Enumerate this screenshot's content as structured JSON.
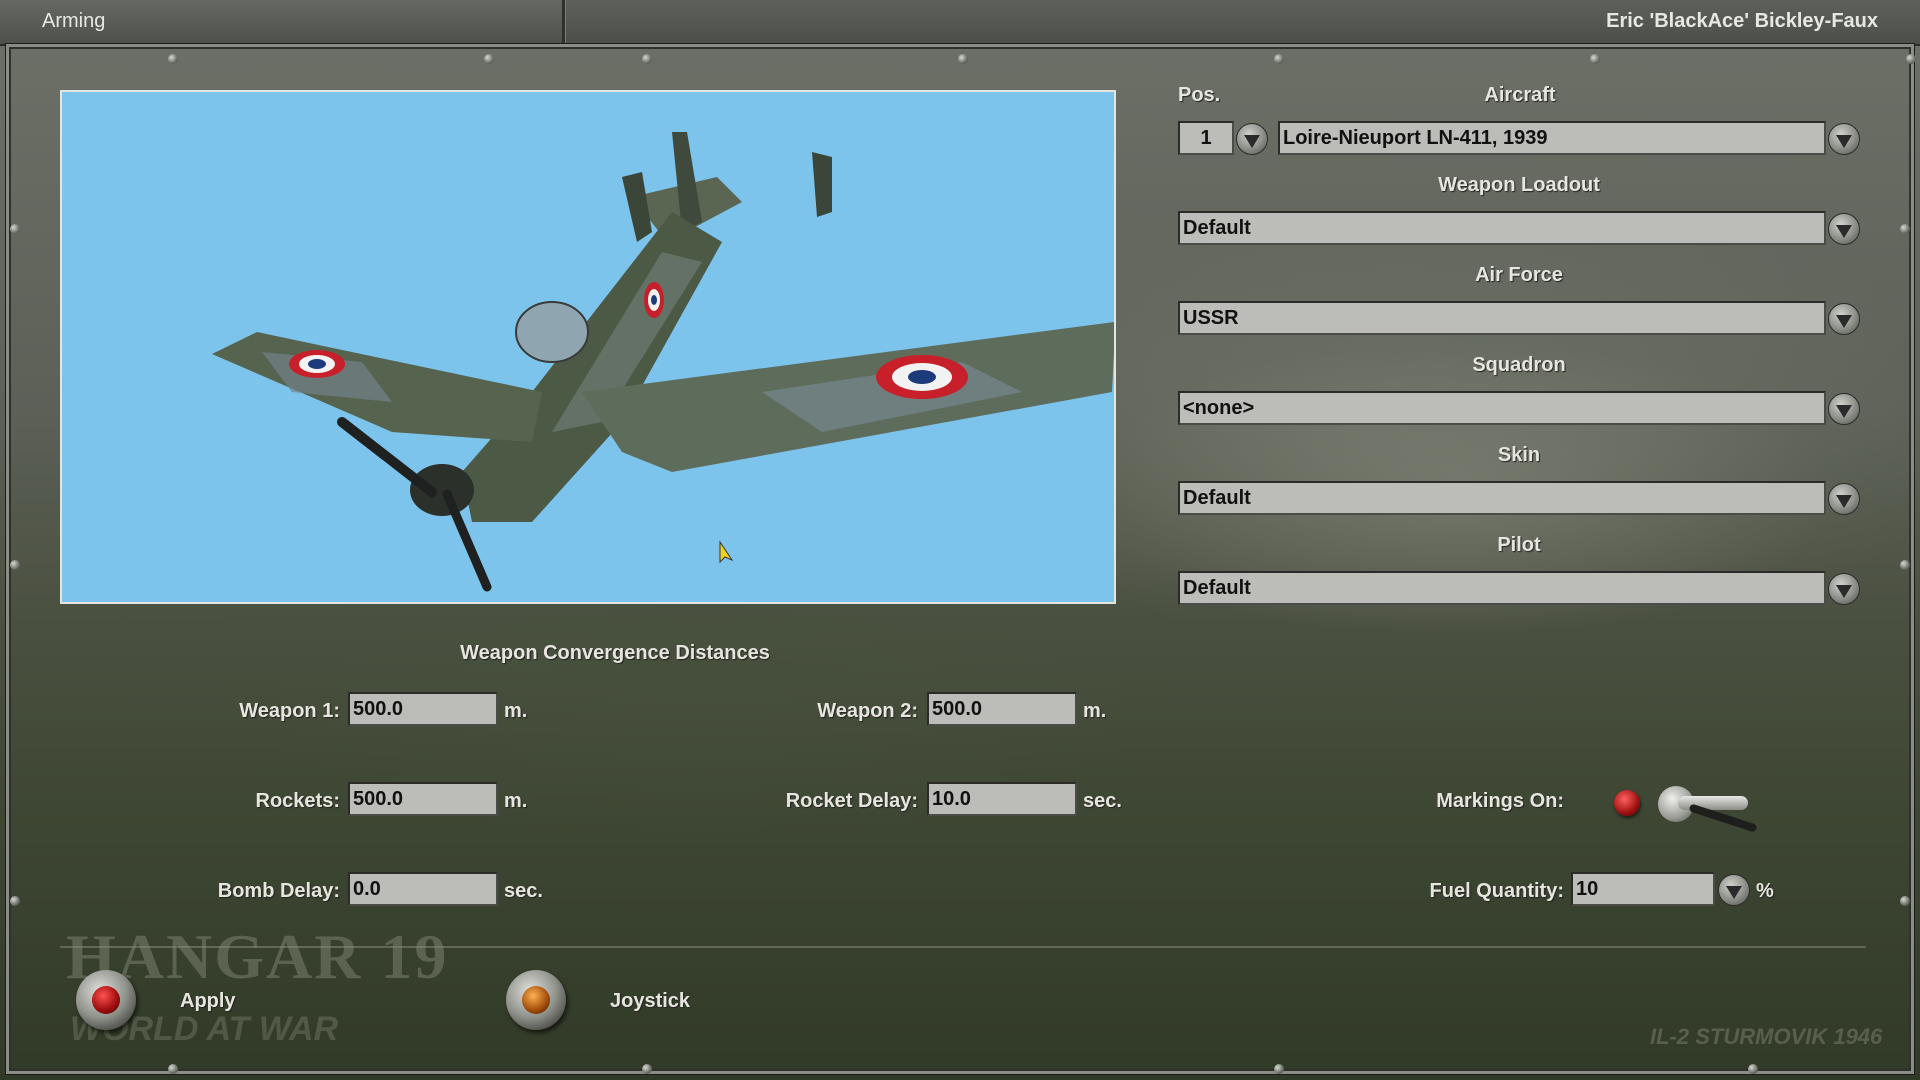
{
  "window": {
    "title": "Arming",
    "user": "Eric 'BlackAce' Bickley-Faux"
  },
  "selection": {
    "pos_label": "Pos.",
    "pos_value": "1",
    "aircraft_label": "Aircraft",
    "aircraft_value": "Loire-Nieuport LN-411, 1939",
    "loadout_label": "Weapon Loadout",
    "loadout_value": "Default",
    "airforce_label": "Air Force",
    "airforce_value": "USSR",
    "squadron_label": "Squadron",
    "squadron_value": "<none>",
    "skin_label": "Skin",
    "skin_value": "Default",
    "pilot_label": "Pilot",
    "pilot_value": "Default"
  },
  "convergence": {
    "heading": "Weapon Convergence Distances",
    "weapon1_label": "Weapon 1:",
    "weapon1_value": "500.0",
    "weapon1_unit": "m.",
    "weapon2_label": "Weapon 2:",
    "weapon2_value": "500.0",
    "weapon2_unit": "m.",
    "rockets_label": "Rockets:",
    "rockets_value": "500.0",
    "rockets_unit": "m.",
    "rocket_delay_label": "Rocket Delay:",
    "rocket_delay_value": "10.0",
    "rocket_delay_unit": "sec.",
    "bomb_delay_label": "Bomb Delay:",
    "bomb_delay_value": "0.0",
    "bomb_delay_unit": "sec."
  },
  "options": {
    "markings_label": "Markings On:",
    "fuel_label": "Fuel Quantity:",
    "fuel_value": "10",
    "fuel_unit": "%"
  },
  "actions": {
    "apply_label": "Apply",
    "joystick_label": "Joystick"
  },
  "watermarks": {
    "hangar": "HANGAR 19",
    "world": "WORLD AT WAR",
    "game": "IL-2 STURMOVIK 1946"
  },
  "colors": {
    "preview_bg": "#7cc4ec",
    "field_bg": "#bcbdb8",
    "label_text": "#e6e6de"
  }
}
